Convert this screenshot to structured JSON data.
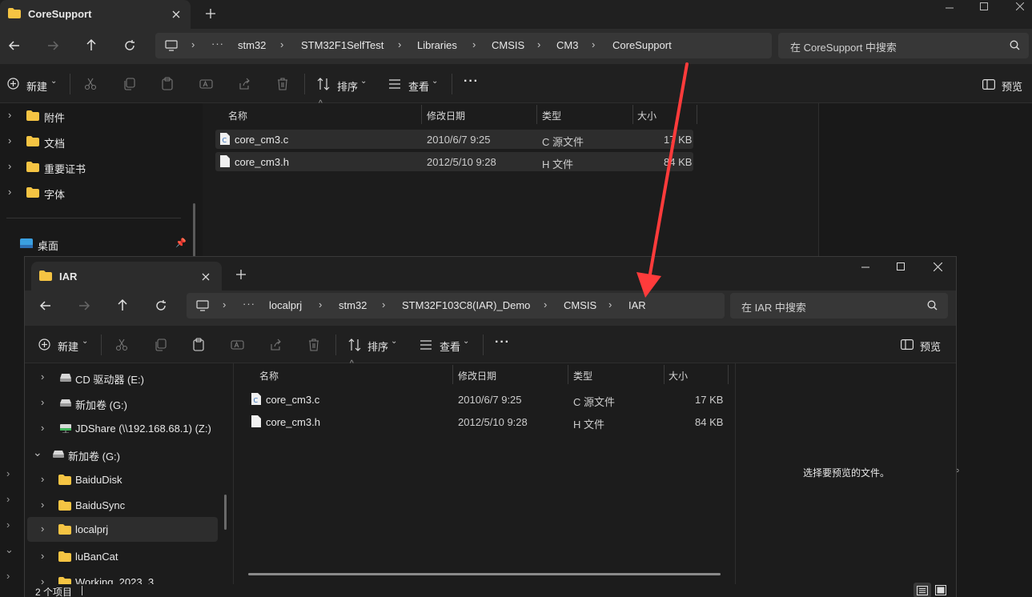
{
  "back_window": {
    "tab_title": "CoreSupport",
    "breadcrumb": [
      "stm32",
      "STM32F1SelfTest",
      "Libraries",
      "CMSIS",
      "CM3",
      "CoreSupport"
    ],
    "search_placeholder": "在 CoreSupport 中搜索",
    "toolbar": {
      "new_label": "新建",
      "sort_label": "排序",
      "view_label": "查看",
      "preview_label": "预览"
    },
    "columns": {
      "name": "名称",
      "date": "修改日期",
      "type": "类型",
      "size": "大小"
    },
    "files": [
      {
        "name": "core_cm3.c",
        "date": "2010/6/7 9:25",
        "type": "C 源文件",
        "size": "17 KB"
      },
      {
        "name": "core_cm3.h",
        "date": "2012/5/10 9:28",
        "type": "H 文件",
        "size": "84 KB"
      }
    ],
    "sidebar": [
      {
        "label": "附件"
      },
      {
        "label": "文档"
      },
      {
        "label": "重要证书"
      },
      {
        "label": "字体"
      }
    ],
    "pinned": {
      "label": "桌面"
    }
  },
  "front_window": {
    "tab_title": "IAR",
    "breadcrumb": [
      "localprj",
      "stm32",
      "STM32F103C8(IAR)_Demo",
      "CMSIS",
      "IAR"
    ],
    "search_placeholder": "在 IAR 中搜索",
    "toolbar": {
      "new_label": "新建",
      "sort_label": "排序",
      "view_label": "查看",
      "preview_label": "预览"
    },
    "columns": {
      "name": "名称",
      "date": "修改日期",
      "type": "类型",
      "size": "大小"
    },
    "files": [
      {
        "name": "core_cm3.c",
        "date": "2010/6/7 9:25",
        "type": "C 源文件",
        "size": "17 KB"
      },
      {
        "name": "core_cm3.h",
        "date": "2012/5/10 9:28",
        "type": "H 文件",
        "size": "84 KB"
      }
    ],
    "sidebar": [
      {
        "label": "CD 驱动器 (E:)"
      },
      {
        "label": "新加卷 (G:)"
      },
      {
        "label": "JDShare (\\\\192.168.68.1) (Z:)"
      },
      {
        "label": "新加卷 (G:)"
      },
      {
        "label": "BaiduDisk"
      },
      {
        "label": "BaiduSync"
      },
      {
        "label": "localprj"
      },
      {
        "label": "luBanCat"
      },
      {
        "label": "Working_2023_3"
      }
    ],
    "preview_message": "选择要预览的文件。",
    "status": "2 个项目"
  },
  "colors": {
    "folder": "#f5c443",
    "accent_arrow": "#ff3b3b",
    "bg": "#1c1c1c"
  },
  "icons": [
    "folder-icon",
    "back-icon",
    "forward-icon",
    "up-icon",
    "refresh-icon",
    "search-icon",
    "cut-icon",
    "copy-icon",
    "paste-icon",
    "rename-icon",
    "share-icon",
    "delete-icon",
    "sort-icon",
    "view-icon",
    "preview-pane-icon",
    "drive-icon",
    "network-drive-icon"
  ]
}
